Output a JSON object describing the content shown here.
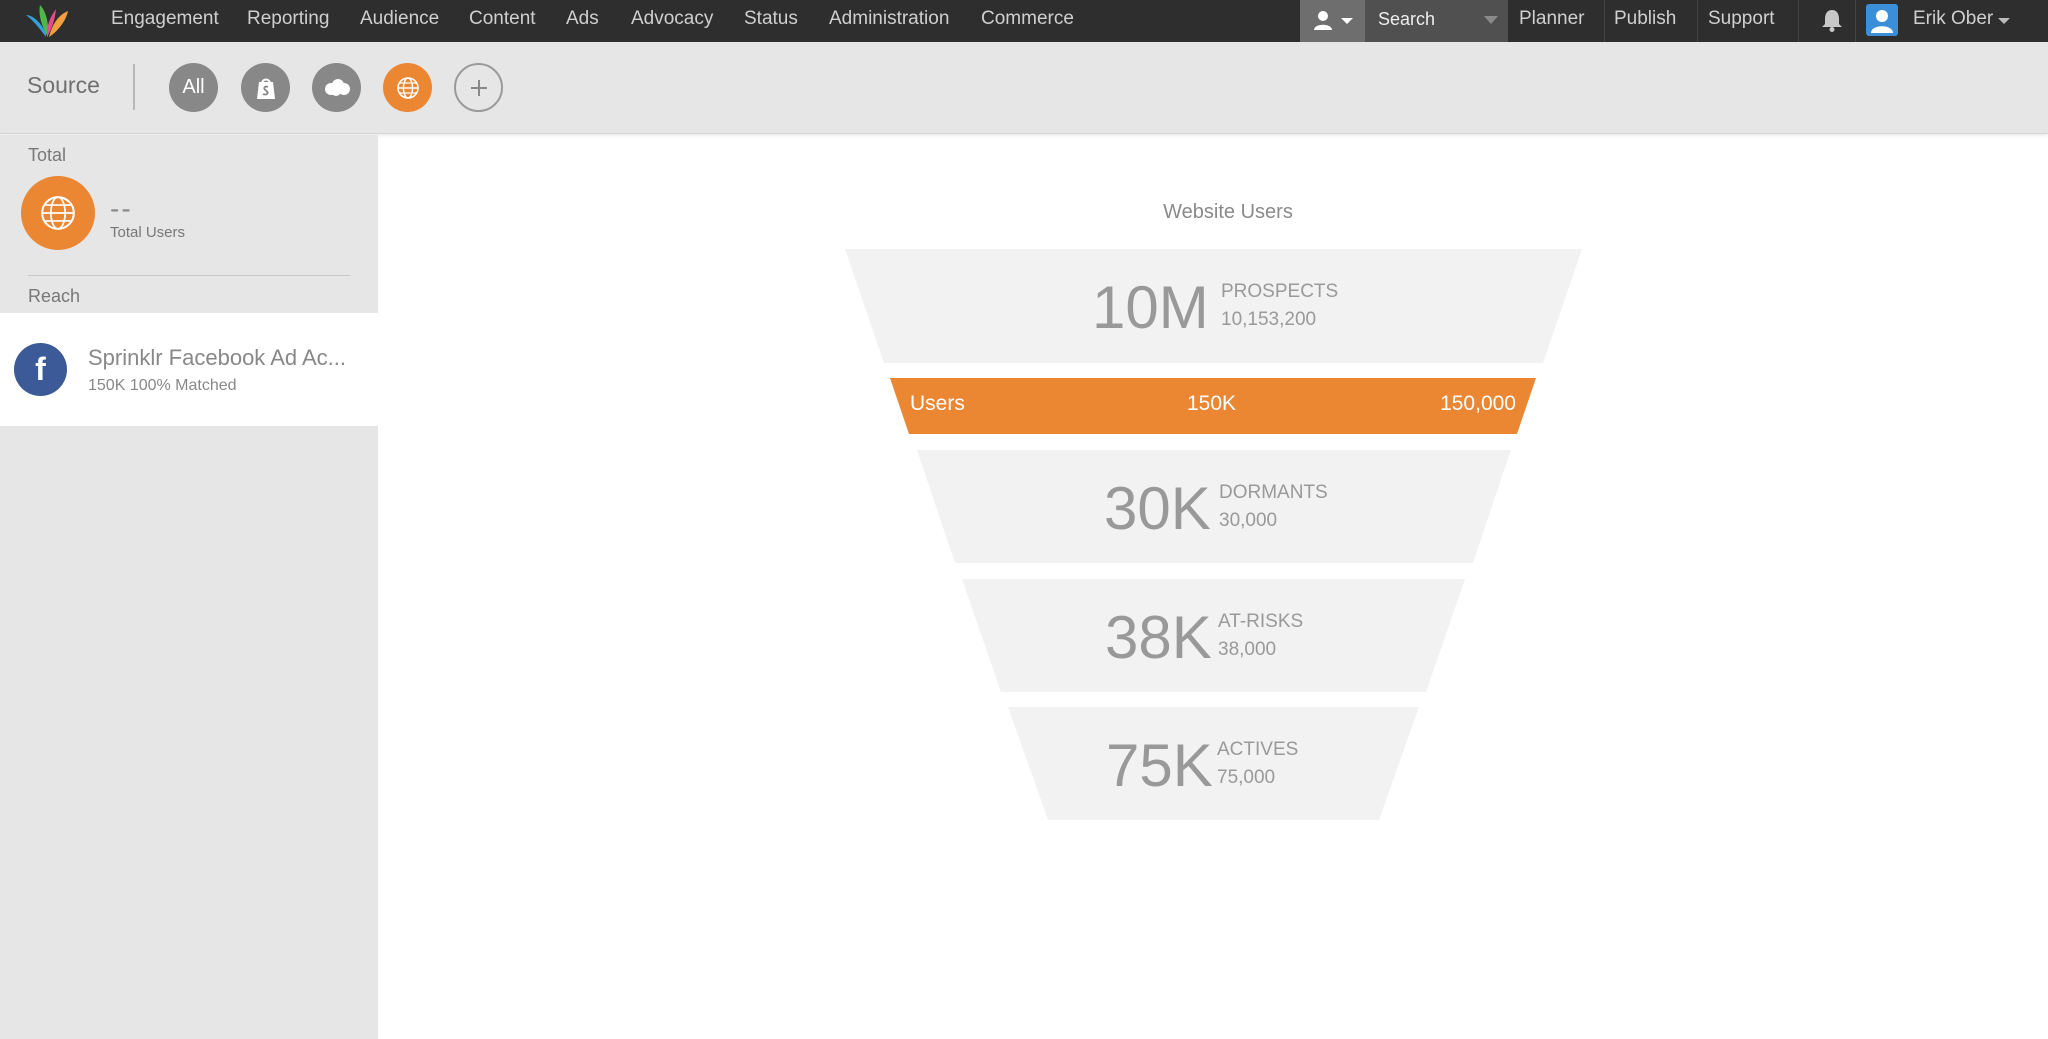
{
  "nav": {
    "items": [
      "Engagement",
      "Reporting",
      "Audience",
      "Content",
      "Ads",
      "Advocacy",
      "Status",
      "Administration",
      "Commerce"
    ],
    "search_label": "Search",
    "right_items": [
      "Planner",
      "Publish",
      "Support"
    ],
    "user_name": "Erik Ober"
  },
  "source": {
    "label": "Source",
    "all_label": "All",
    "buttons": [
      "shopify-icon",
      "salesforce-icon",
      "globe-icon",
      "plus-icon"
    ],
    "active_color": "#eb8633"
  },
  "sidebar": {
    "total_label": "Total",
    "total_value": "--",
    "total_caption": "Total Users",
    "reach_label": "Reach",
    "reach_title": "Sprinklr Facebook Ad Ac...",
    "reach_sub": "150K 100% Matched"
  },
  "funnel": {
    "title": "Website Users",
    "stages": [
      {
        "big": "10M",
        "label": "PROSPECTS",
        "value": "10,153,200"
      },
      {
        "big": "30K",
        "label": "DORMANTS",
        "value": "30,000"
      },
      {
        "big": "38K",
        "label": "AT-RISKS",
        "value": "38,000"
      },
      {
        "big": "75K",
        "label": "ACTIVES",
        "value": "75,000"
      }
    ],
    "users_bar": {
      "label": "Users",
      "mid": "150K",
      "value": "150,000",
      "color": "#eb8633"
    }
  }
}
